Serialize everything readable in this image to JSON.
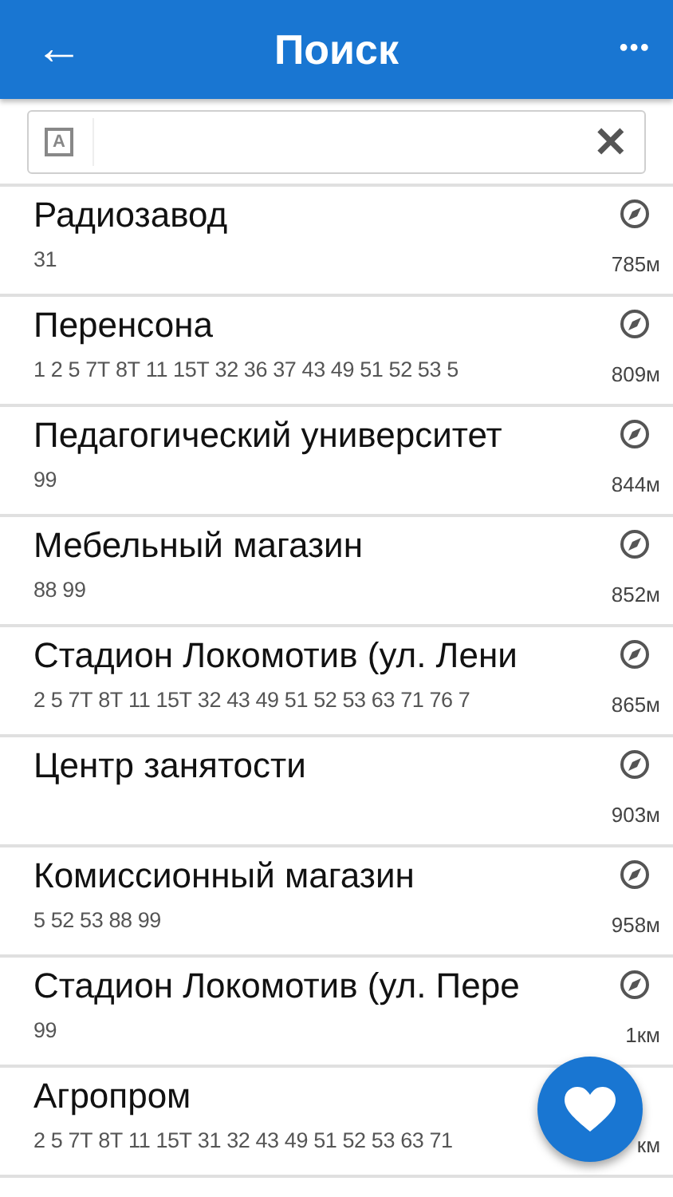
{
  "header": {
    "back": "←",
    "title": "Поиск",
    "more": "•••"
  },
  "search": {
    "badge": "A",
    "clear": "✕"
  },
  "stops": [
    {
      "name": "Радиозавод",
      "routes": "31",
      "distance": "785м"
    },
    {
      "name": "Перенсона",
      "routes": "1 2 5 7Т 8Т 11 15Т 32 36 37 43 49 51 52 53 5",
      "distance": "809м"
    },
    {
      "name": "Педагогический университет",
      "routes": "99",
      "distance": "844м"
    },
    {
      "name": "Мебельный магазин",
      "routes": "88 99",
      "distance": "852м"
    },
    {
      "name": "Стадион Локомотив (ул. Лени",
      "routes": "2 5 7Т 8Т 11 15Т 32 43 49 51 52 53 63 71 76 7",
      "distance": "865м"
    },
    {
      "name": "Центр занятости",
      "distance": "903м"
    },
    {
      "name": "Комиссионный магазин",
      "routes": "5 52 53 88 99",
      "distance": "958м"
    },
    {
      "name": "Стадион Локомотив (ул. Пере",
      "routes": "99",
      "distance": "1км"
    },
    {
      "name": "Агропром",
      "routes": "2 5 7Т 8Т 11 15Т 31 32 43 49 51 52 53 63 71",
      "distance": "км",
      "icon_covered": true
    }
  ]
}
